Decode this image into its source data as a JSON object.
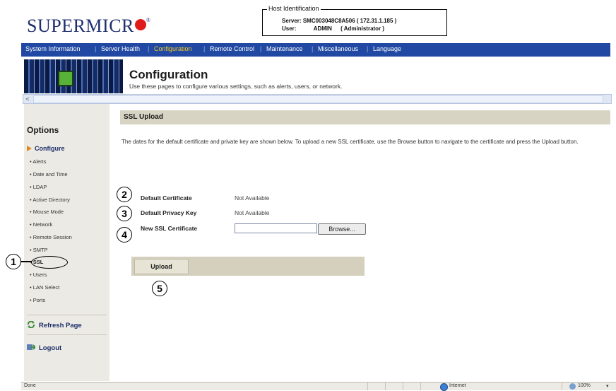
{
  "brand": {
    "logo_text": "SUPERMICR",
    "registered": "®"
  },
  "host": {
    "legend": "Host Identification",
    "server_label": "Server:",
    "server_value": "SMC003048C8A506 ( 172.31.1.185 )",
    "user_label": "User:",
    "user_value": "ADMIN",
    "user_role": "( Administrator )"
  },
  "nav": {
    "items": [
      "System Information",
      "Server Health",
      "Configuration",
      "Remote Control",
      "Maintenance",
      "Miscellaneous",
      "Language"
    ],
    "active": "Configuration",
    "separator": "|"
  },
  "banner": {
    "title": "Configuration",
    "description": "Use these pages to configure various settings, such as alerts, users, or network."
  },
  "scrollbar": {
    "left_arrow": "<"
  },
  "sidebar": {
    "title": "Options",
    "group": "Configure",
    "items": [
      "Alerts",
      "Date and Time",
      "LDAP",
      "Active Directory",
      "Mouse Mode",
      "Network",
      "Remote Session",
      "SMTP",
      "SSL",
      "Users",
      "LAN Select",
      "Ports"
    ],
    "active_item": "SSL",
    "bullet": "•",
    "refresh_label": "Refresh Page",
    "logout_label": "Logout"
  },
  "main": {
    "section_title": "SSL Upload",
    "intro": "The dates for the default certificate and private key are shown below. To upload a new SSL certificate, use the Browse button to navigate to the certificate and press the Upload button.",
    "fields": {
      "default_cert_label": "Default Certificate",
      "default_cert_value": "Not Available",
      "default_key_label": "Default Privacy Key",
      "default_key_value": "Not Available",
      "new_cert_label": "New SSL Certificate",
      "new_cert_value": ""
    },
    "browse_label": "Browse...",
    "upload_label": "Upload"
  },
  "callouts": [
    "1",
    "2",
    "3",
    "4",
    "5"
  ],
  "statusbar": {
    "left_text": "Done",
    "zone": "Internet",
    "zoom": "100%",
    "zoom_arrow": "▾"
  },
  "colors": {
    "nav_bg": "#2149a3",
    "nav_active": "#f2cc22",
    "brand": "#1f2f6e",
    "logo_dot": "#e01b1b",
    "section_bg": "#d8d4c4",
    "sidebar_bg": "#eceae4"
  }
}
